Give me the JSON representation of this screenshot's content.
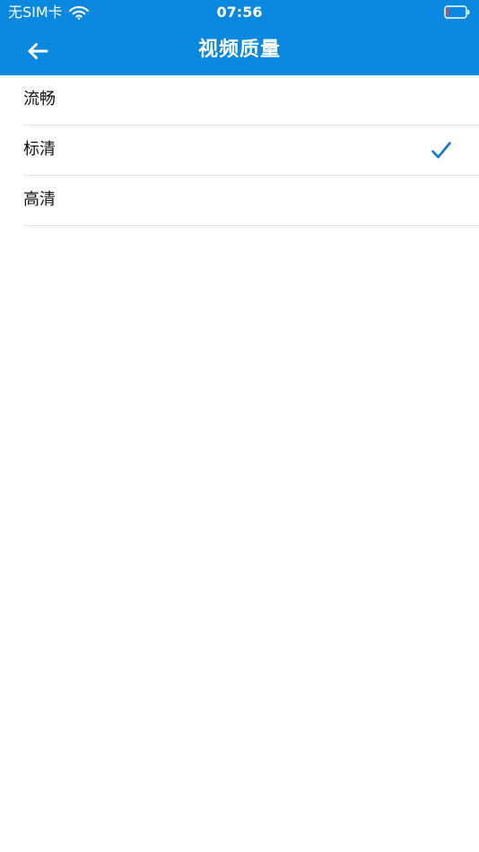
{
  "status_bar": {
    "carrier": "无SIM卡",
    "time": "07:56",
    "wifi_icon": "wifi-icon",
    "battery_icon": "battery-icon",
    "battery_level_fraction": 0.12
  },
  "navigation": {
    "title": "视频质量",
    "back_icon": "back-arrow-icon"
  },
  "quality_options": [
    {
      "label": "流畅"
    },
    {
      "label": "标清",
      "selected_icon": "check-icon"
    },
    {
      "label": "高清"
    }
  ],
  "selected_index": 1,
  "colors": {
    "header_blue": "#0a88e0",
    "text": "#111111",
    "divider": "#e3e3e3",
    "check_blue": "#1477d4",
    "battery_red": "#ff3b30"
  }
}
